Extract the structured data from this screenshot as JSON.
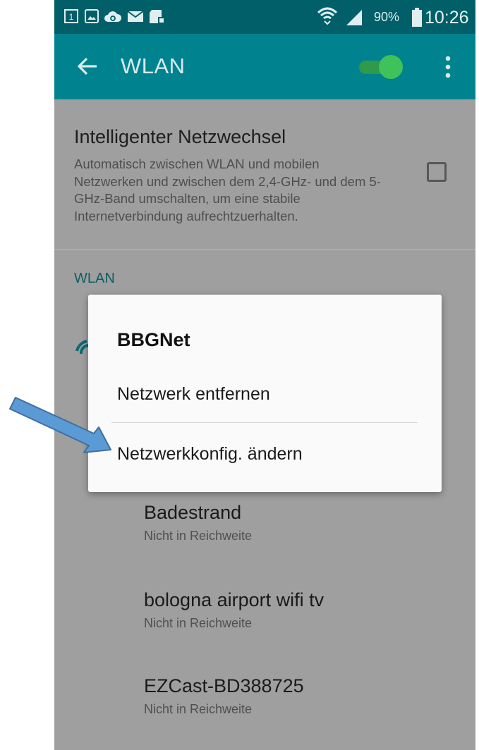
{
  "status_bar": {
    "battery": "90%",
    "time": "10:26",
    "notification_icons": [
      "sim-1-icon",
      "image-icon",
      "cloud-sync-icon",
      "mail-icon",
      "sd-card-icon"
    ]
  },
  "app_bar": {
    "title": "WLAN",
    "wifi_toggle": "on"
  },
  "smart_network_switch": {
    "title": "Intelligenter Netzwechsel",
    "description": "Automatisch zwischen WLAN und mobilen Netzwerken und zwischen dem 2,4-GHz- und dem 5-GHz-Band umschalten, um eine stabile Internetverbindung aufrechtzuerhalten.",
    "checked": false
  },
  "wlan_section": {
    "header": "WLAN",
    "networks": [
      {
        "name": "Badestrand",
        "status": "Nicht in Reichweite"
      },
      {
        "name": "bologna airport wifi tv",
        "status": "Nicht in Reichweite"
      },
      {
        "name": "EZCast-BD388725",
        "status": "Nicht in Reichweite"
      }
    ]
  },
  "dialog": {
    "title": "BBGNet",
    "items": [
      "Netzwerk entfernen",
      "Netzwerkkonfig. ändern"
    ]
  },
  "colors": {
    "status_bar": "#005f68",
    "app_bar": "#00838f",
    "toggle_on": "#3fc25a",
    "annotation_arrow": "#5b9bd5"
  }
}
